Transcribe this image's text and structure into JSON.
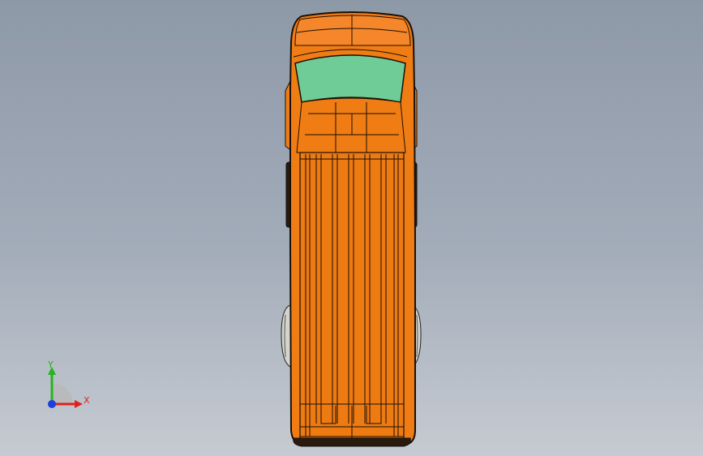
{
  "viewport": {
    "background_top": "#8e99a8",
    "background_bottom": "#c6cbd2"
  },
  "model": {
    "body_color": "#f07c14",
    "body_edge_color": "#1a1008",
    "glass_color": "#6fcc97",
    "tire_color": "#d0d0c8"
  },
  "triad": {
    "x_label": "X",
    "y_label": "Y",
    "x_color": "#e0201c",
    "y_color": "#26b31e",
    "z_color": "#1c3fe0"
  }
}
